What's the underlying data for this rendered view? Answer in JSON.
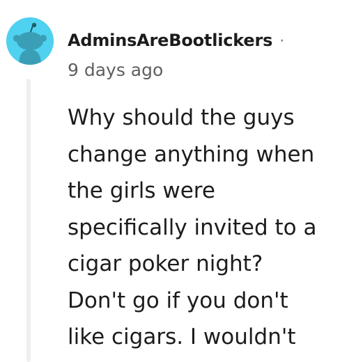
{
  "comment": {
    "author": "AdminsAreBootlickers",
    "separator": "·",
    "timestamp": "9 days ago",
    "avatar_icon": "reddit-snoo-avatar-icon",
    "avatar_color": "#4fd1f0",
    "body_lines": [
      "Why should the guys",
      "change anything when",
      "the girls were",
      "specifically invited to a",
      "cigar poker night?",
      "Don't go if you don't",
      "like cigars. I wouldn't"
    ]
  }
}
